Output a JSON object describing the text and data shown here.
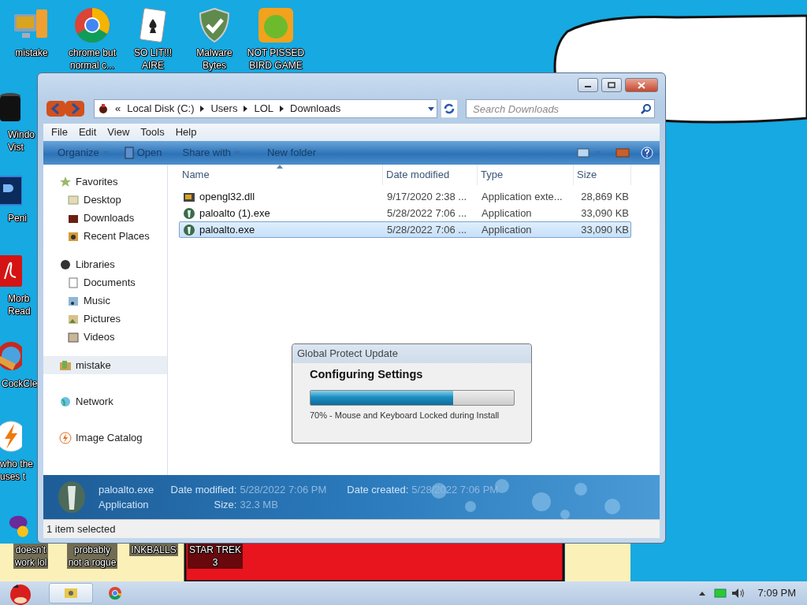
{
  "desktop_icons": [
    {
      "lines": [
        "mistake"
      ]
    },
    {
      "lines": [
        "chrome but",
        "normal c..."
      ]
    },
    {
      "lines": [
        "SO LIT!!!",
        "AIRE"
      ]
    },
    {
      "lines": [
        "Malware",
        "Bytes"
      ]
    },
    {
      "lines": [
        "NOT PISSED",
        "BIRD GAME"
      ]
    },
    {
      "lines": [
        "Windo",
        "Vist"
      ]
    },
    {
      "lines": [
        "Peni"
      ]
    },
    {
      "lines": [
        "Morb",
        "Read"
      ]
    },
    {
      "lines": [
        "CockCle"
      ]
    },
    {
      "lines": [
        "who the",
        "uses t"
      ]
    },
    {
      "lines": [
        "doesn't",
        "work lol"
      ]
    },
    {
      "lines": [
        "probably",
        "not a rogue"
      ]
    },
    {
      "lines": [
        "INKBALLS"
      ]
    },
    {
      "lines": [
        "STAR TREK",
        "3"
      ]
    }
  ],
  "explorer": {
    "address": {
      "crumbs": [
        "«",
        "Local Disk (C:)",
        "Users",
        "LOL",
        "Downloads"
      ]
    },
    "search": {
      "placeholder": "Search Downloads"
    },
    "menu": [
      "File",
      "Edit",
      "View",
      "Tools",
      "Help"
    ],
    "toolbar": [
      {
        "label": "Organize",
        "kind": "dropdown"
      },
      {
        "label": "Open",
        "kind": "icon"
      },
      {
        "label": "Share with",
        "kind": "dropdown"
      },
      {
        "label": "New folder",
        "kind": "plain"
      }
    ],
    "sidebar": [
      {
        "label": "Favorites",
        "selected": false,
        "children": [
          {
            "label": "Desktop",
            "selected": false
          },
          {
            "label": "Downloads",
            "selected": false
          },
          {
            "label": "Recent Places",
            "selected": false
          }
        ]
      },
      {
        "label": "Libraries",
        "selected": false,
        "children": [
          {
            "label": "Documents",
            "selected": false
          },
          {
            "label": "Music",
            "selected": false
          },
          {
            "label": "Pictures",
            "selected": false
          },
          {
            "label": "Videos",
            "selected": false
          }
        ]
      },
      {
        "label": "mistake",
        "selected": true
      },
      {
        "label": "Network",
        "selected": false
      },
      {
        "label": "Image Catalog",
        "selected": false
      }
    ],
    "columns": [
      "Name",
      "Date modified",
      "Type",
      "Size"
    ],
    "files": [
      {
        "name": "opengl32.dll",
        "date": "9/17/2020 2:38 ...",
        "type": "Application exte...",
        "size": "28,869 KB",
        "selected": false
      },
      {
        "name": "paloalto (1).exe",
        "date": "5/28/2022 7:06 ...",
        "type": "Application",
        "size": "33,090 KB",
        "selected": false
      },
      {
        "name": "paloalto.exe",
        "date": "5/28/2022 7:06 ...",
        "type": "Application",
        "size": "33,090 KB",
        "selected": true
      }
    ],
    "details": {
      "name": "paloalto.exe",
      "type": "Application",
      "fields": [
        {
          "label": "Date modified:",
          "value": "5/28/2022 7:06 PM"
        },
        {
          "label": "Size:",
          "value": "32.3 MB"
        },
        {
          "label": "Date created:",
          "value": "5/28/2022 7:06 PM"
        }
      ]
    },
    "status_bar": "1 item selected"
  },
  "dialog": {
    "title": "Global Protect Update",
    "heading": "Configuring Settings",
    "level": 0.7,
    "message": "70% - Mouse and Keyboard Locked during Install"
  },
  "taskbar": {
    "buttons": [
      {
        "selected": true
      },
      {
        "selected": false
      }
    ],
    "time": "7:09 PM"
  }
}
